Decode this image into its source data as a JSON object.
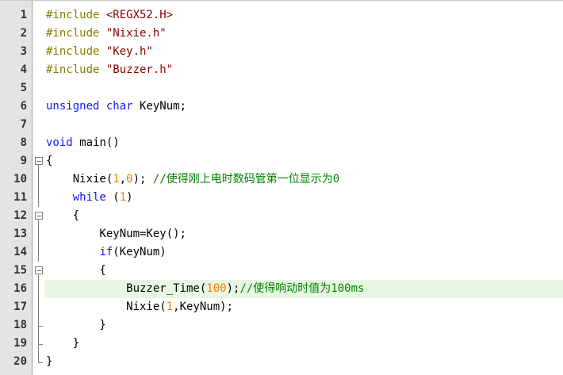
{
  "editor": {
    "lines": [
      {
        "no": "1",
        "fold": "",
        "tokens": [
          {
            "t": "#include ",
            "c": "pp"
          },
          {
            "t": "<REGX52.H>",
            "c": "str"
          }
        ]
      },
      {
        "no": "2",
        "fold": "",
        "tokens": [
          {
            "t": "#include ",
            "c": "pp"
          },
          {
            "t": "\"Nixie.h\"",
            "c": "str"
          }
        ]
      },
      {
        "no": "3",
        "fold": "",
        "tokens": [
          {
            "t": "#include ",
            "c": "pp"
          },
          {
            "t": "\"Key.h\"",
            "c": "str"
          }
        ]
      },
      {
        "no": "4",
        "fold": "",
        "tokens": [
          {
            "t": "#include ",
            "c": "pp"
          },
          {
            "t": "\"Buzzer.h\"",
            "c": "str"
          }
        ]
      },
      {
        "no": "5",
        "fold": "",
        "tokens": []
      },
      {
        "no": "6",
        "fold": "",
        "tokens": [
          {
            "t": "unsigned char ",
            "c": "kw"
          },
          {
            "t": "KeyNum;",
            "c": ""
          }
        ]
      },
      {
        "no": "7",
        "fold": "",
        "tokens": []
      },
      {
        "no": "8",
        "fold": "",
        "tokens": [
          {
            "t": "void ",
            "c": "kw"
          },
          {
            "t": "main()",
            "c": ""
          }
        ]
      },
      {
        "no": "9",
        "fold": "open",
        "tokens": [
          {
            "t": "{",
            "c": ""
          }
        ]
      },
      {
        "no": "10",
        "fold": "line",
        "tokens": [
          {
            "t": "    Nixie(",
            "c": ""
          },
          {
            "t": "1",
            "c": "numlit"
          },
          {
            "t": ",",
            "c": ""
          },
          {
            "t": "0",
            "c": "numlit"
          },
          {
            "t": "); ",
            "c": ""
          },
          {
            "t": "//使得刚上电时数码管第一位显示为0",
            "c": "com"
          }
        ]
      },
      {
        "no": "11",
        "fold": "line",
        "tokens": [
          {
            "t": "    ",
            "c": ""
          },
          {
            "t": "while",
            "c": "kw"
          },
          {
            "t": " (",
            "c": ""
          },
          {
            "t": "1",
            "c": "numlit"
          },
          {
            "t": ")",
            "c": ""
          }
        ]
      },
      {
        "no": "12",
        "fold": "open",
        "tokens": [
          {
            "t": "    {",
            "c": ""
          }
        ]
      },
      {
        "no": "13",
        "fold": "line",
        "tokens": [
          {
            "t": "        KeyNum=Key();",
            "c": ""
          }
        ]
      },
      {
        "no": "14",
        "fold": "line",
        "tokens": [
          {
            "t": "        ",
            "c": ""
          },
          {
            "t": "if",
            "c": "kw"
          },
          {
            "t": "(KeyNum)",
            "c": ""
          }
        ]
      },
      {
        "no": "15",
        "fold": "open",
        "tokens": [
          {
            "t": "        {",
            "c": ""
          }
        ]
      },
      {
        "no": "16",
        "fold": "line",
        "hl": true,
        "tokens": [
          {
            "t": "            Buzzer_Time(",
            "c": ""
          },
          {
            "t": "100",
            "c": "numlit"
          },
          {
            "t": ");",
            "c": ""
          },
          {
            "t": "//使得响动时值为100ms",
            "c": "com"
          }
        ]
      },
      {
        "no": "17",
        "fold": "line",
        "tokens": [
          {
            "t": "            Nixie(",
            "c": ""
          },
          {
            "t": "1",
            "c": "numlit"
          },
          {
            "t": ",KeyNum);",
            "c": ""
          }
        ]
      },
      {
        "no": "18",
        "fold": "end",
        "tokens": [
          {
            "t": "        }",
            "c": ""
          }
        ]
      },
      {
        "no": "19",
        "fold": "end",
        "tokens": [
          {
            "t": "    }",
            "c": ""
          }
        ]
      },
      {
        "no": "20",
        "fold": "end",
        "tokens": [
          {
            "t": "}",
            "c": ""
          }
        ]
      }
    ]
  }
}
